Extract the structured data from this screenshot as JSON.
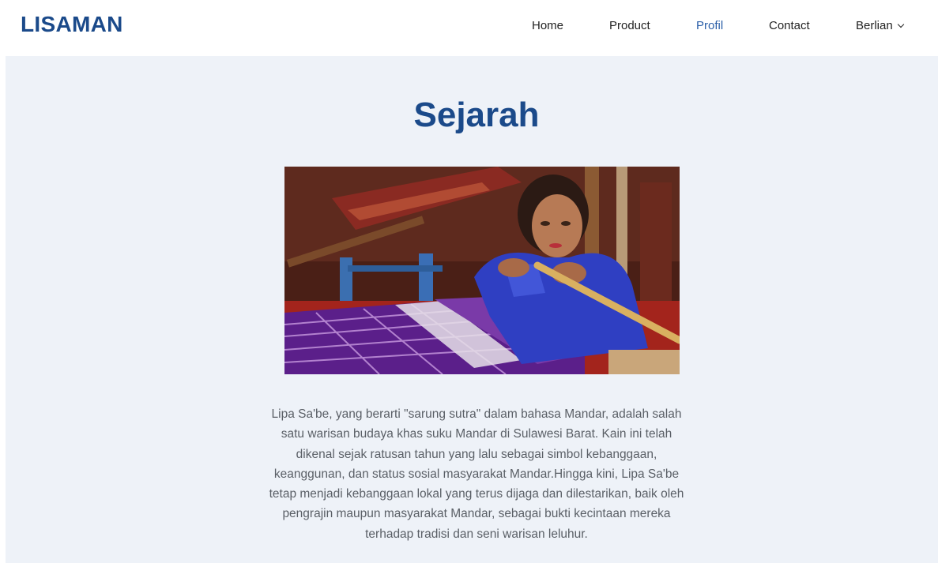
{
  "brand": "LISAMAN",
  "nav": {
    "home": "Home",
    "product": "Product",
    "profil": "Profil",
    "contact": "Contact",
    "user": "Berlian",
    "active": "Profil",
    "active_color": "#2a5ea8"
  },
  "page": {
    "title": "Sejarah",
    "paragraph": "Lipa Sa'be, yang berarti \"sarung sutra\" dalam bahasa Mandar, adalah salah satu warisan budaya khas suku Mandar di Sulawesi Barat. Kain ini telah dikenal sejak ratusan tahun yang lalu sebagai simbol kebanggaan, keanggunan, dan status sosial masyarakat Mandar.Hingga kini, Lipa Sa'be tetap menjadi kebanggaan lokal yang terus dijaga dan dilestarikan, baik oleh pengrajin maupun masyarakat Mandar, sebagai bukti kecintaan mereka terhadap tradisi dan seni warisan leluhur."
  },
  "colors": {
    "brand": "#1b4a8a",
    "background": "#eef2f8",
    "text": "#5a5f66"
  }
}
